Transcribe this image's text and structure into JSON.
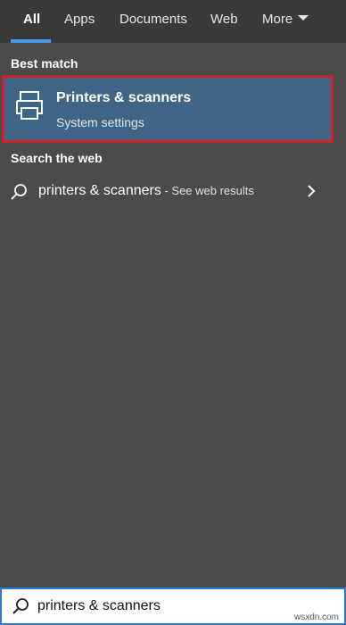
{
  "tabs": [
    {
      "label": "All",
      "active": true
    },
    {
      "label": "Apps"
    },
    {
      "label": "Documents"
    },
    {
      "label": "Web"
    },
    {
      "label": "More"
    }
  ],
  "best_match": {
    "heading": "Best match",
    "title": "Printers & scanners",
    "subtitle": "System settings",
    "icon": "printer-icon"
  },
  "search_web": {
    "heading": "Search the web",
    "query": "printers & scanners",
    "suffix": " - See web results",
    "icon": "search-icon",
    "arrow_icon": "chevron-right-icon"
  },
  "search_box": {
    "value": "printers & scanners",
    "icon": "search-icon"
  },
  "watermark": "wsxdn.com",
  "colors": {
    "accent": "#4c9be8",
    "selection": "#3f6585",
    "highlight_border": "#d11f2b",
    "panel": "#4b4b4b"
  }
}
